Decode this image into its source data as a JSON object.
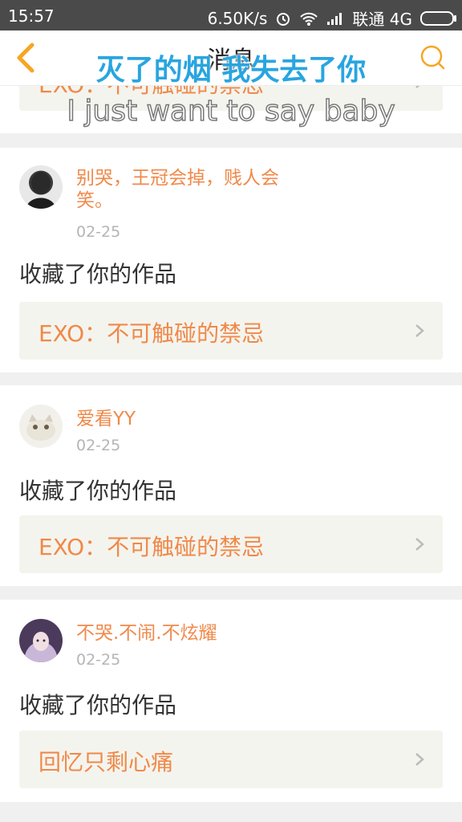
{
  "status_bar": {
    "time": "15:57",
    "speed": "6.50K/s",
    "carrier": "联通 4G",
    "icons": [
      "alarm-icon",
      "wifi-icon",
      "signal-icon",
      "battery-icon"
    ]
  },
  "header": {
    "title": "消息",
    "back_icon": "chevron-left-icon",
    "search_icon": "search-icon",
    "accent_color": "#f5a623"
  },
  "overlay": {
    "line1": "灭了的烟 我失去了你",
    "line2": "I just want to say baby"
  },
  "notifications": [
    {
      "work_title": "EXO：不可触碰的禁忌"
    },
    {
      "user": "别哭，王冠会掉，贱人会笑。",
      "date": "02-25",
      "action": "收藏了你的作品",
      "work_title": "EXO：不可触碰的禁忌"
    },
    {
      "user": "爱看YY",
      "date": "02-25",
      "action": "收藏了你的作品",
      "work_title": "EXO：不可触碰的禁忌"
    },
    {
      "user": "不哭.不闹.不炫耀",
      "date": "02-25",
      "action": "收藏了你的作品",
      "work_title": "回忆只剩心痛"
    }
  ],
  "colors": {
    "name": "#f0894a",
    "date": "#b5b5b5",
    "work_bg": "#f4f4ee",
    "overlay_line1": "#29a5e0"
  }
}
